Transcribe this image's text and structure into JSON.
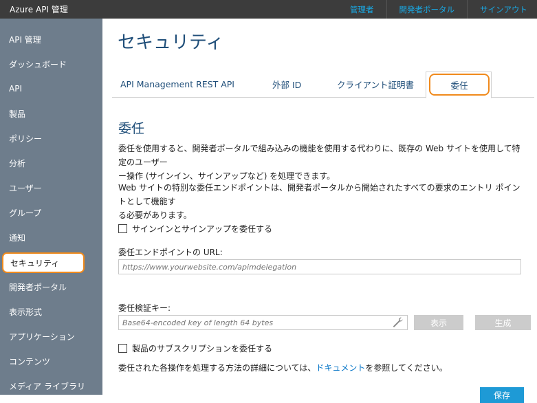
{
  "app": {
    "title": "Azure API 管理"
  },
  "top_links": [
    "管理者",
    "開発者ポータル",
    "サインアウト"
  ],
  "sidebar": {
    "items": [
      {
        "label": "API 管理"
      },
      {
        "label": "ダッシュボード"
      },
      {
        "label": "API"
      },
      {
        "label": "製品"
      },
      {
        "label": "ポリシー"
      },
      {
        "label": "分析"
      },
      {
        "label": "ユーザー"
      },
      {
        "label": "グループ"
      },
      {
        "label": "通知"
      },
      {
        "label": "セキュリティ"
      },
      {
        "label": "開発者ポータル"
      },
      {
        "label": "表示形式"
      },
      {
        "label": "アプリケーション"
      },
      {
        "label": "コンテンツ"
      },
      {
        "label": "メディア ライブラリ"
      }
    ],
    "active": "セキュリティ"
  },
  "page": {
    "title": "セキュリティ"
  },
  "tabs": [
    {
      "label": "API Management REST API"
    },
    {
      "label": "外部 ID"
    },
    {
      "label": "クライアント証明書"
    },
    {
      "label": "委任"
    }
  ],
  "active_tab": "委任",
  "delegation": {
    "title": "委任",
    "para1_line1": "委任を使用すると、開発者ポータルで組み込みの機能を使用する代わりに、既存の Web サイトを使用して特定のユーザー",
    "para1_line2": "ー操作 (サインイン、サインアップなど) を処理できます。",
    "para2_line1": "Web サイトの特別な委任エンドポイントは、開発者ポータルから開始されたすべての要求のエントリ ポイントとして機能す",
    "para2_line2": "る必要があります。",
    "signin_checkbox_label": "サインインとサインアップを委任する",
    "signin_checked": false,
    "endpoint_label": "委任エンドポイントの URL:",
    "endpoint_placeholder": "https://www.yourwebsite.com/apimdelegation",
    "key_label": "委任検証キー:",
    "key_placeholder": "Base64-encoded key of length 64 bytes",
    "show_button": "表示",
    "generate_button": "生成",
    "subscription_checkbox_label": "製品のサブスクリプションを委任する",
    "subscription_checked": false,
    "footer_before": "委任された各操作を処理する方法の詳細については、",
    "footer_link": "ドキュメント",
    "footer_after": "を参照してください。",
    "save_button": "保存"
  },
  "colors": {
    "accent": "#1e9ad6",
    "highlight": "#f08a1c",
    "sidebar_bg": "#6e7d8c",
    "topbar_bg": "#3c3c3c",
    "title_blue": "#1f4e79"
  }
}
